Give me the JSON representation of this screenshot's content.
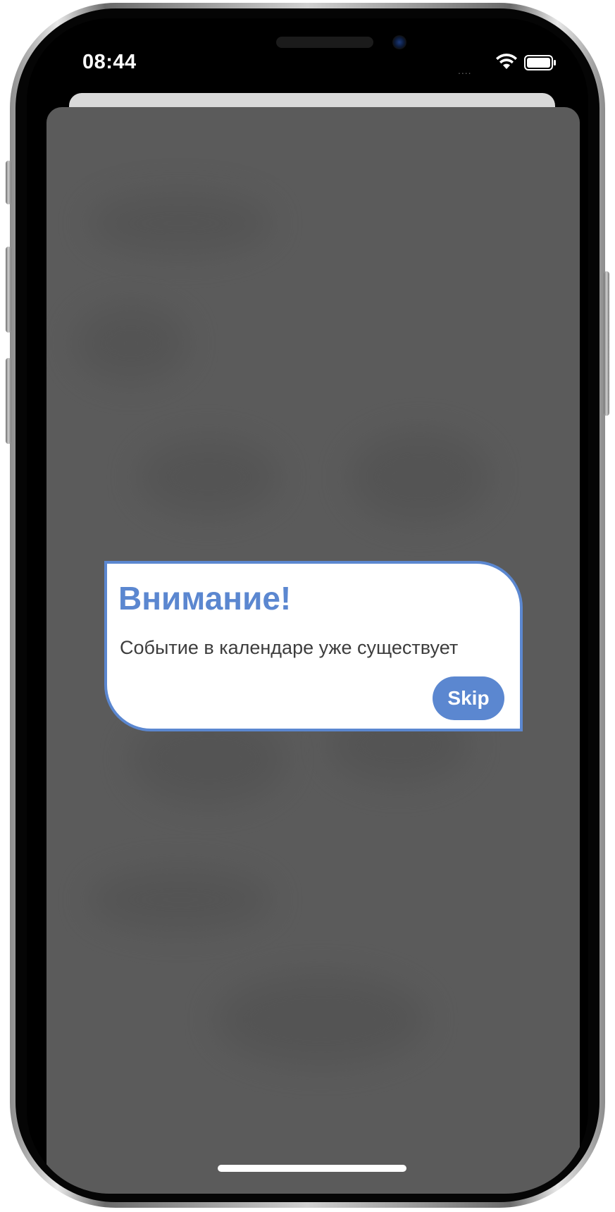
{
  "status_bar": {
    "time": "08:44",
    "signal": "....",
    "wifi_icon": "wifi-icon",
    "battery_icon": "battery-icon"
  },
  "alert": {
    "title": "Внимание!",
    "message": "Событие в календаре уже существует",
    "skip_label": "Skip"
  },
  "colors": {
    "accent": "#5b87d0",
    "overlay": "#5b5b5b",
    "message_text": "#3d3d3d"
  }
}
